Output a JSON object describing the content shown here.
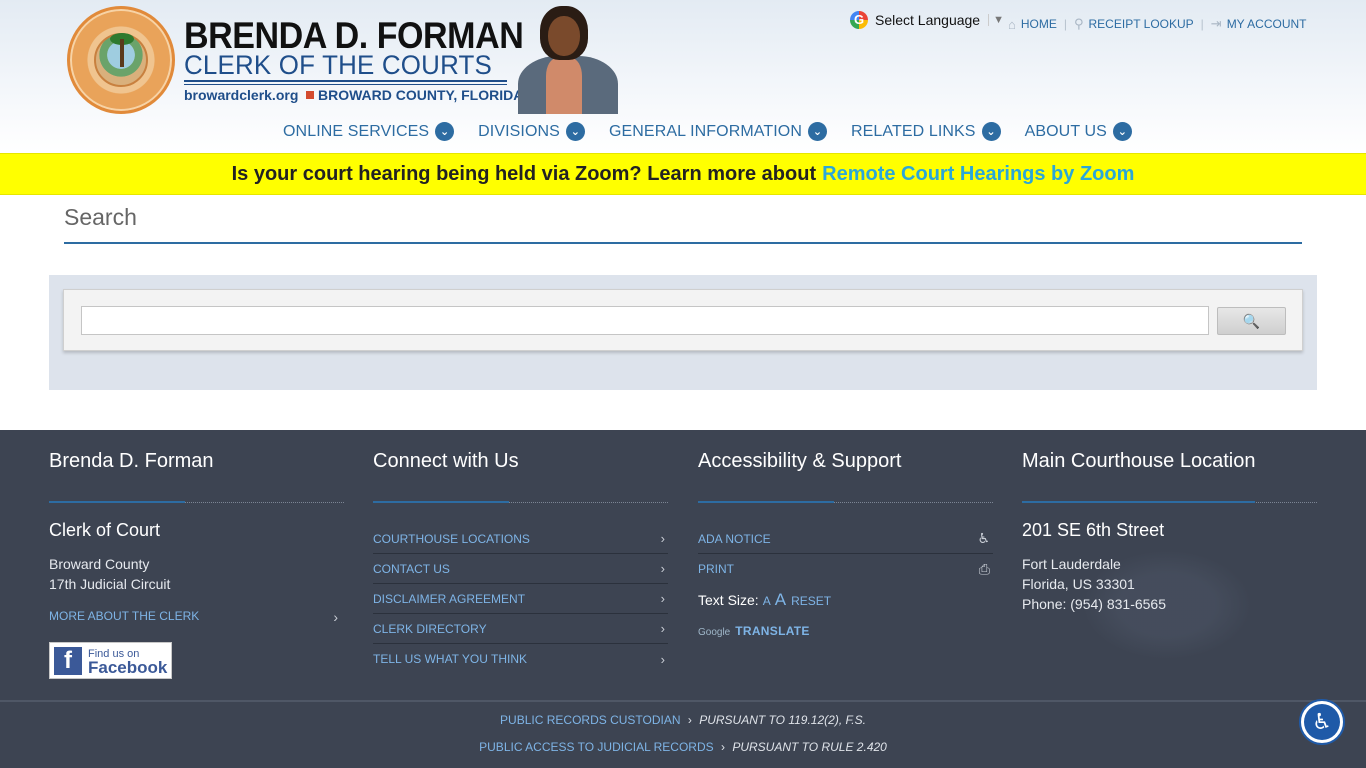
{
  "header": {
    "brand_name": "BRENDA D. FORMAN",
    "brand_sub": "CLERK OF THE COURTS",
    "brand_url": "browardclerk.org",
    "brand_county": "BROWARD COUNTY, FLORIDA",
    "language_label": "Select Language",
    "language_caret": "▼",
    "top_links": [
      {
        "icon": "home-icon",
        "glyph": "⌂",
        "label": "HOME"
      },
      {
        "icon": "magnifier-icon",
        "glyph": "⚲",
        "label": "RECEIPT LOOKUP"
      },
      {
        "icon": "sign-in-icon",
        "glyph": "⇥",
        "label": "MY ACCOUNT"
      }
    ],
    "separator": "|",
    "nav": [
      {
        "label": "ONLINE SERVICES"
      },
      {
        "label": "DIVISIONS"
      },
      {
        "label": "GENERAL INFORMATION"
      },
      {
        "label": "RELATED LINKS"
      },
      {
        "label": "ABOUT US"
      }
    ],
    "nav_chevron": "⌄"
  },
  "banner": {
    "text": "Is your court hearing being held via Zoom? Learn more about",
    "link": "Remote Court Hearings by Zoom",
    "background": "#ffff00"
  },
  "search": {
    "title": "Search",
    "input_value": "",
    "button_glyph": "🔍"
  },
  "footer": {
    "col1": {
      "title": "Brenda D. Forman",
      "subtitle": "Clerk of Court",
      "line1": "Broward County",
      "line2": "17th Judicial Circuit",
      "link": "MORE ABOUT THE CLERK",
      "fb_small": "Find us on",
      "fb_big": "Facebook",
      "fb_f": "f"
    },
    "col2": {
      "title": "Connect with Us",
      "links": [
        "COURTHOUSE LOCATIONS",
        "CONTACT US",
        "DISCLAIMER AGREEMENT",
        "CLERK DIRECTORY",
        "TELL US WHAT YOU THINK"
      ]
    },
    "col3": {
      "title": "Accessibility & Support",
      "links": [
        {
          "label": "ADA NOTICE",
          "icon": "wheelchair-icon",
          "glyph": "♿"
        },
        {
          "label": "PRINT",
          "icon": "printer-icon",
          "glyph": "⎙"
        }
      ],
      "text_size_label": "Text Size:",
      "text_size_small": "A",
      "text_size_large": "A",
      "text_size_reset": "RESET",
      "google_word": "Google",
      "translate": "TRANSLATE"
    },
    "col4": {
      "title": "Main Courthouse Location",
      "street": "201 SE 6th Street",
      "city": "Fort Lauderdale",
      "state_zip": "Florida, US 33301",
      "phone": "Phone: (954) 831-6565"
    },
    "arrow": "›"
  },
  "bottom": {
    "line1_link": "PUBLIC RECORDS CUSTODIAN",
    "line1_text": "PURSUANT TO 119.12(2), F.S.",
    "line2_link": "PUBLIC ACCESS TO JUDICIAL RECORDS",
    "line2_text": "PURSUANT TO RULE 2.420",
    "sep": "›"
  },
  "colors": {
    "accent": "#2d6ca2",
    "footer_bg": "#3d4452",
    "link": "#7eb4e6",
    "banner_link": "#2ba7d8"
  }
}
